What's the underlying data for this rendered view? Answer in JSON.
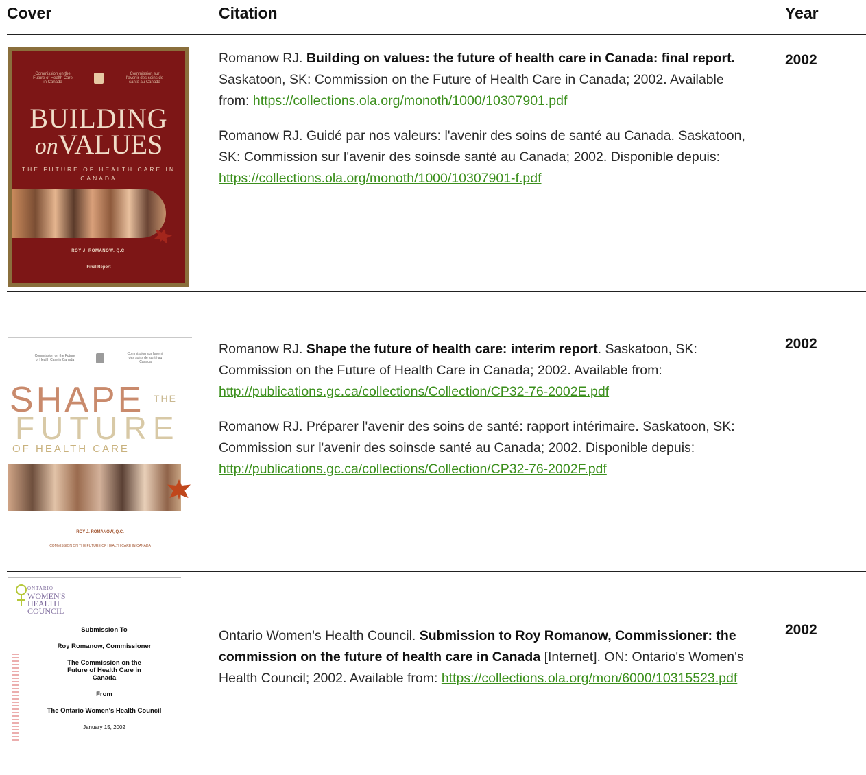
{
  "header": {
    "cover": "Cover",
    "citation": "Citation",
    "year": "Year"
  },
  "rows": [
    {
      "year": "2002",
      "cover": {
        "gov_en": "Commission on the Future of Health Care in Canada",
        "gov_fr": "Commission sur l'avenir des soins de santé au Canada",
        "title_line1": "BUILDING",
        "title_on": "on",
        "title_line2": "VALUES",
        "subtitle": "THE FUTURE OF HEALTH CARE IN CANADA",
        "author": "ROY J. ROMANOW, Q.C.",
        "report": "Final Report"
      },
      "citations": [
        {
          "pre": "Romanow RJ. ",
          "bold": "Building on values: the future of health care in Canada: final report.",
          "post": " Saskatoon, SK: Commission on the Future of Health Care in Canada; 2002. Available from: ",
          "link": "https://collections.ola.org/monoth/1000/10307901.pdf"
        },
        {
          "pre": "Romanow RJ. Guidé par nos valeurs: l'avenir des soins de santé au Canada. Saskatoon, SK: Commission sur l'avenir des soinsde santé au Canada; 2002. Disponible depuis: ",
          "bold": "",
          "post": "",
          "link": "https://collections.ola.org/monoth/1000/10307901-f.pdf"
        }
      ]
    },
    {
      "year": "2002",
      "cover": {
        "gov_en": "Commission on the Future of Health Care in Canada",
        "gov_fr": "Commission sur l'avenir des soins de santé au Canada",
        "shape": "SHAPE",
        "the": "THE",
        "future": "FUTURE",
        "ohc": "OF HEALTH CARE",
        "author": "ROY J. ROMANOW, Q.C.",
        "commission": "COMMISSION ON THE FUTURE OF HEALTH CARE IN CANADA"
      },
      "citations": [
        {
          "pre": "Romanow RJ. ",
          "bold": "Shape the future of health care: interim report",
          "post": ". Saskatoon, SK: Commission on the Future of Health Care in Canada; 2002. Available from: ",
          "link": "http://publications.gc.ca/collections/Collection/CP32-76-2002E.pdf"
        },
        {
          "pre": "Romanow RJ. Préparer l'avenir des soins de santé: rapport intérimaire. Saskatoon, SK: Commission sur l'avenir des soinsde santé au Canada; 2002. Disponible depuis: ",
          "bold": "",
          "post": "",
          "link": "http://publications.gc.ca/collections/Collection/CP32-76-2002F.pdf"
        }
      ]
    },
    {
      "year": "2002",
      "cover": {
        "logo_small": "ONTARIO",
        "logo1": "WOMEN'S",
        "logo2": "HEALTH",
        "logo3": "COUNCIL",
        "line1": "Submission To",
        "line2": "Roy Romanow, Commissioner",
        "line3": "The Commission on the Future of Health Care in Canada",
        "line4": "From",
        "line5": "The Ontario Women's Health Council",
        "line6": "January 15, 2002"
      },
      "citations": [
        {
          "pre": "Ontario Women's Health Council. ",
          "bold": "Submission to Roy Romanow, Commissioner: the commission on the future of health care in Canada",
          "post": " [Internet]. ON: Ontario's Women's Health Council; 2002. Available from: ",
          "link": "https://collections.ola.org/mon/6000/10315523.pdf"
        }
      ]
    }
  ]
}
